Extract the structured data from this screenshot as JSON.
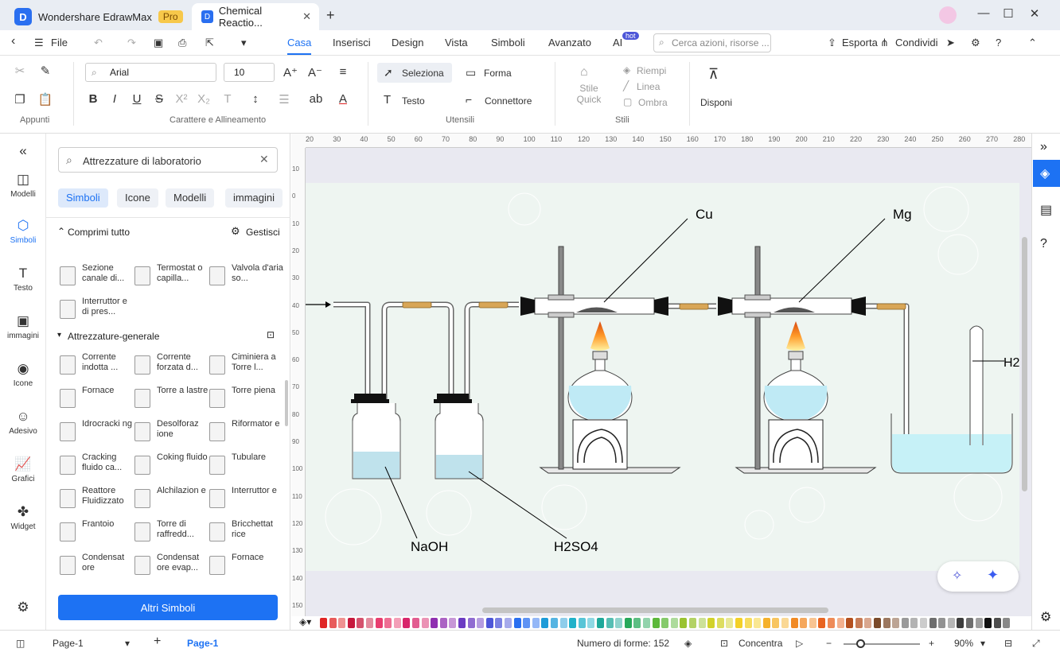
{
  "app": {
    "name": "Wondershare EdrawMax",
    "badge": "Pro",
    "doc_tab": "Chemical Reactio..."
  },
  "menu": {
    "file": "File",
    "tabs": [
      "Casa",
      "Inserisci",
      "Design",
      "Vista",
      "Simboli",
      "Avanzato",
      "AI"
    ],
    "ai_badge": "hot",
    "search_placeholder": "Cerca azioni, risorse ...",
    "export": "Esporta",
    "share": "Condividi"
  },
  "ribbon": {
    "font": "Arial",
    "size": "10",
    "select": "Seleziona",
    "shape": "Forma",
    "text": "Testo",
    "connector": "Connettore",
    "quick_style": "Stile Quick",
    "fill": "Riempi",
    "line": "Linea",
    "shadow": "Ombra",
    "arrange": "Disponi",
    "groups": {
      "clipboard": "Appunti",
      "font": "Carattere e Allineamento",
      "tools": "Utensili",
      "styles": "Stili"
    }
  },
  "rail": {
    "items": [
      "Modelli",
      "Simboli",
      "Testo",
      "immagini",
      "Icone",
      "Adesivo",
      "Grafici",
      "Widget"
    ]
  },
  "library": {
    "search": "Attrezzature di laboratorio",
    "chips": [
      "Simboli",
      "Icone",
      "Modelli",
      "immagini"
    ],
    "collapse_all": "Comprimi tutto",
    "manage": "Gestisci",
    "top_items": [
      "Sezione canale di...",
      "Termostat o capilla...",
      "Valvola d'aria so...",
      "Interruttor e di pres..."
    ],
    "category": "Attrezzature-generale",
    "items": [
      "Corrente indotta ...",
      "Corrente forzata d...",
      "Ciminiera a Torre l...",
      "Fornace",
      "Torre a lastre",
      "Torre piena",
      "Idrocracki ng",
      "Desolforaz ione",
      "Riformator e",
      "Cracking fluido ca...",
      "Coking fluido",
      "Tubulare",
      "Reattore Fluidizzato",
      "Alchilazion e",
      "Interruttor e",
      "Frantoio",
      "Torre di raffredd...",
      "Bricchettat rice",
      "Condensat ore",
      "Condensat ore evap...",
      "Fornace"
    ],
    "more": "Altri Simboli"
  },
  "ruler": {
    "top": [
      "20",
      "30",
      "40",
      "50",
      "60",
      "70",
      "80",
      "90",
      "100",
      "110",
      "120",
      "130",
      "140",
      "150",
      "160",
      "170",
      "180",
      "190",
      "200",
      "210",
      "220",
      "230",
      "240",
      "250",
      "260",
      "270",
      "280"
    ],
    "left": [
      "10",
      "0",
      "10",
      "20",
      "30",
      "40",
      "50",
      "60",
      "70",
      "80",
      "90",
      "100",
      "110",
      "120",
      "130",
      "140",
      "150"
    ]
  },
  "diagram": {
    "labels": {
      "cu": "Cu",
      "mg": "Mg",
      "h2": "H2",
      "naoh": "NaOH",
      "h2so4": "H2SO4"
    }
  },
  "palette": [
    "#e02424",
    "#c7183d",
    "#e83d6f",
    "#d8266b",
    "#8f2fb0",
    "#6b3bc2",
    "#4d56d8",
    "#2a6ff0",
    "#1d9bd8",
    "#20b1c9",
    "#1ea89a",
    "#26a85a",
    "#5cb83a",
    "#9ac331",
    "#d1d12a",
    "#f3d027",
    "#f5b12b",
    "#f18a25",
    "#e86420",
    "#b4501f",
    "#7a4a2a",
    "#999999",
    "#6e6e6e",
    "#3d3d3d",
    "#111111"
  ],
  "status": {
    "page_select": "Page-1",
    "page_tab": "Page-1",
    "shapes": "Numero di forme: 152",
    "focus": "Concentra",
    "zoom": "90%"
  }
}
